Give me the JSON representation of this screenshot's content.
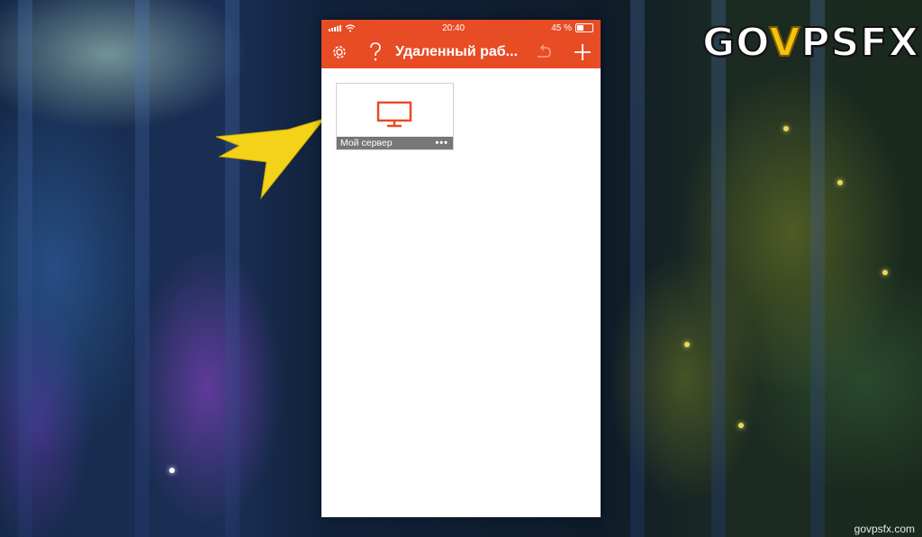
{
  "statusbar": {
    "time": "20:40",
    "battery": "45 %",
    "battery_level": 0.45
  },
  "navbar": {
    "title": "Удаленный раб...",
    "icons": [
      "gear-icon",
      "help-icon",
      "refresh-icon",
      "add-icon"
    ]
  },
  "tiles": [
    {
      "label": "Мой сервер",
      "icon": "monitor-icon",
      "more": "•••"
    }
  ],
  "branding": {
    "logo_text": "GOVPSFX",
    "logo_parts": [
      "GO",
      "V",
      "PSFX"
    ],
    "watermark": "govpsfx.com"
  },
  "colors": {
    "accent": "#e74c25",
    "arrow": "#f5d21a",
    "tile_footer": "#777777"
  }
}
